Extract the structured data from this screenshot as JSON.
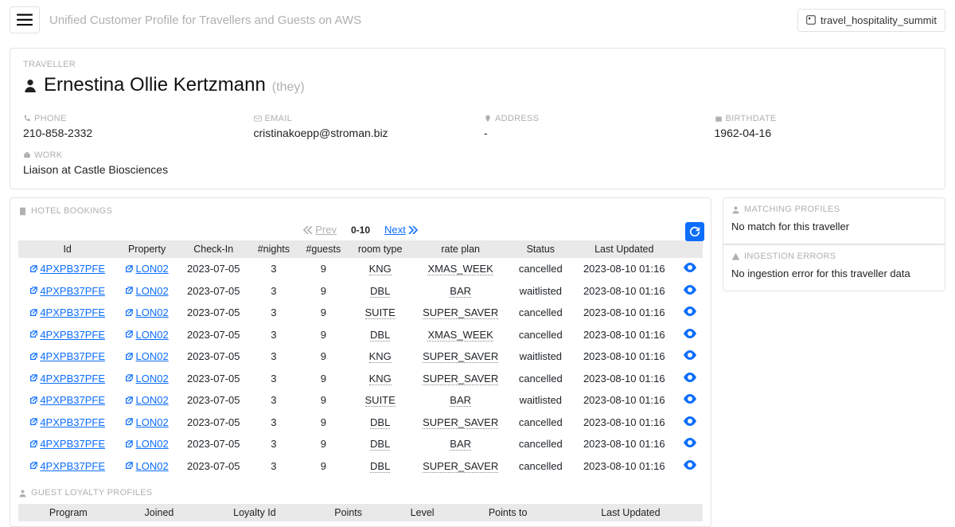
{
  "header": {
    "app_title": "Unified Customer Profile for Travellers and Guests on AWS",
    "domain_selected": "travel_hospitality_summit"
  },
  "profile": {
    "section_label": "TRAVELLER",
    "name": "Ernestina Ollie Kertzmann",
    "pronouns": "(they)",
    "phone_label": "PHONE",
    "phone": "210-858-2332",
    "email_label": "EMAIL",
    "email": "cristinakoepp@stroman.biz",
    "address_label": "ADDRESS",
    "address": "-",
    "birthdate_label": "BIRTHDATE",
    "birthdate": "1962-04-16",
    "work_label": "WORK",
    "work": "Liaison at Castle Biosciences"
  },
  "hotel": {
    "title": "HOTEL BOOKINGS",
    "pager": {
      "prev": "Prev",
      "range": "0-10",
      "next": "Next"
    },
    "columns": [
      "Id",
      "Property",
      "Check-In",
      "#nights",
      "#guests",
      "room type",
      "rate plan",
      "Status",
      "Last Updated",
      ""
    ],
    "rows": [
      {
        "id": "4PXPB37PFE",
        "property": "LON02",
        "checkin": "2023-07-05",
        "nights": "3",
        "guests": "9",
        "room": "KNG",
        "rate": "XMAS_WEEK",
        "status": "cancelled",
        "updated": "2023-08-10 01:16"
      },
      {
        "id": "4PXPB37PFE",
        "property": "LON02",
        "checkin": "2023-07-05",
        "nights": "3",
        "guests": "9",
        "room": "DBL",
        "rate": "BAR",
        "status": "waitlisted",
        "updated": "2023-08-10 01:16"
      },
      {
        "id": "4PXPB37PFE",
        "property": "LON02",
        "checkin": "2023-07-05",
        "nights": "3",
        "guests": "9",
        "room": "SUITE",
        "rate": "SUPER_SAVER",
        "status": "cancelled",
        "updated": "2023-08-10 01:16"
      },
      {
        "id": "4PXPB37PFE",
        "property": "LON02",
        "checkin": "2023-07-05",
        "nights": "3",
        "guests": "9",
        "room": "DBL",
        "rate": "XMAS_WEEK",
        "status": "cancelled",
        "updated": "2023-08-10 01:16"
      },
      {
        "id": "4PXPB37PFE",
        "property": "LON02",
        "checkin": "2023-07-05",
        "nights": "3",
        "guests": "9",
        "room": "KNG",
        "rate": "SUPER_SAVER",
        "status": "waitlisted",
        "updated": "2023-08-10 01:16"
      },
      {
        "id": "4PXPB37PFE",
        "property": "LON02",
        "checkin": "2023-07-05",
        "nights": "3",
        "guests": "9",
        "room": "KNG",
        "rate": "SUPER_SAVER",
        "status": "cancelled",
        "updated": "2023-08-10 01:16"
      },
      {
        "id": "4PXPB37PFE",
        "property": "LON02",
        "checkin": "2023-07-05",
        "nights": "3",
        "guests": "9",
        "room": "SUITE",
        "rate": "BAR",
        "status": "waitlisted",
        "updated": "2023-08-10 01:16"
      },
      {
        "id": "4PXPB37PFE",
        "property": "LON02",
        "checkin": "2023-07-05",
        "nights": "3",
        "guests": "9",
        "room": "DBL",
        "rate": "SUPER_SAVER",
        "status": "cancelled",
        "updated": "2023-08-10 01:16"
      },
      {
        "id": "4PXPB37PFE",
        "property": "LON02",
        "checkin": "2023-07-05",
        "nights": "3",
        "guests": "9",
        "room": "DBL",
        "rate": "BAR",
        "status": "cancelled",
        "updated": "2023-08-10 01:16"
      },
      {
        "id": "4PXPB37PFE",
        "property": "LON02",
        "checkin": "2023-07-05",
        "nights": "3",
        "guests": "9",
        "room": "DBL",
        "rate": "SUPER_SAVER",
        "status": "cancelled",
        "updated": "2023-08-10 01:16"
      }
    ]
  },
  "loyalty": {
    "title": "GUEST LOYALTY PROFILES",
    "columns": [
      "Program",
      "Joined",
      "Loyalty Id",
      "Points",
      "Level",
      "Points to",
      "Last Updated"
    ]
  },
  "side": {
    "matching_title": "MATCHING PROFILES",
    "matching_text": "No match for this traveller",
    "errors_title": "INGESTION ERRORS",
    "errors_text": "No ingestion error for this traveller data"
  }
}
